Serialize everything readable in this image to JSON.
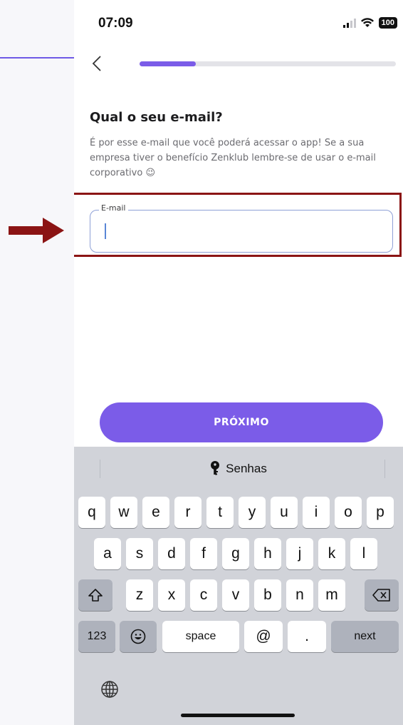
{
  "status_bar": {
    "time": "07:09",
    "battery": "100"
  },
  "progress": {
    "fraction": 0.22
  },
  "header": {
    "back_icon": "chevron-left-icon"
  },
  "form": {
    "question": "Qual o seu e-mail?",
    "description": "É por esse e-mail que você poderá acessar o app! Se a sua empresa tiver o benefício Zenklub lembre-se de usar o e-mail corporativo 😉",
    "email_label": "E-mail",
    "email_value": ""
  },
  "next_button": {
    "label": "PRÓXIMO"
  },
  "keyboard": {
    "suggestion": "Senhas",
    "row1": [
      "q",
      "w",
      "e",
      "r",
      "t",
      "y",
      "u",
      "i",
      "o",
      "p"
    ],
    "row2": [
      "a",
      "s",
      "d",
      "f",
      "g",
      "h",
      "j",
      "k",
      "l"
    ],
    "row3": [
      "z",
      "x",
      "c",
      "v",
      "b",
      "n",
      "m"
    ],
    "key_123": "123",
    "key_space": "space",
    "key_at": "@",
    "key_dot": ".",
    "key_next": "next"
  },
  "colors": {
    "accent": "#7b5ce8",
    "highlight": "#8b1414"
  }
}
